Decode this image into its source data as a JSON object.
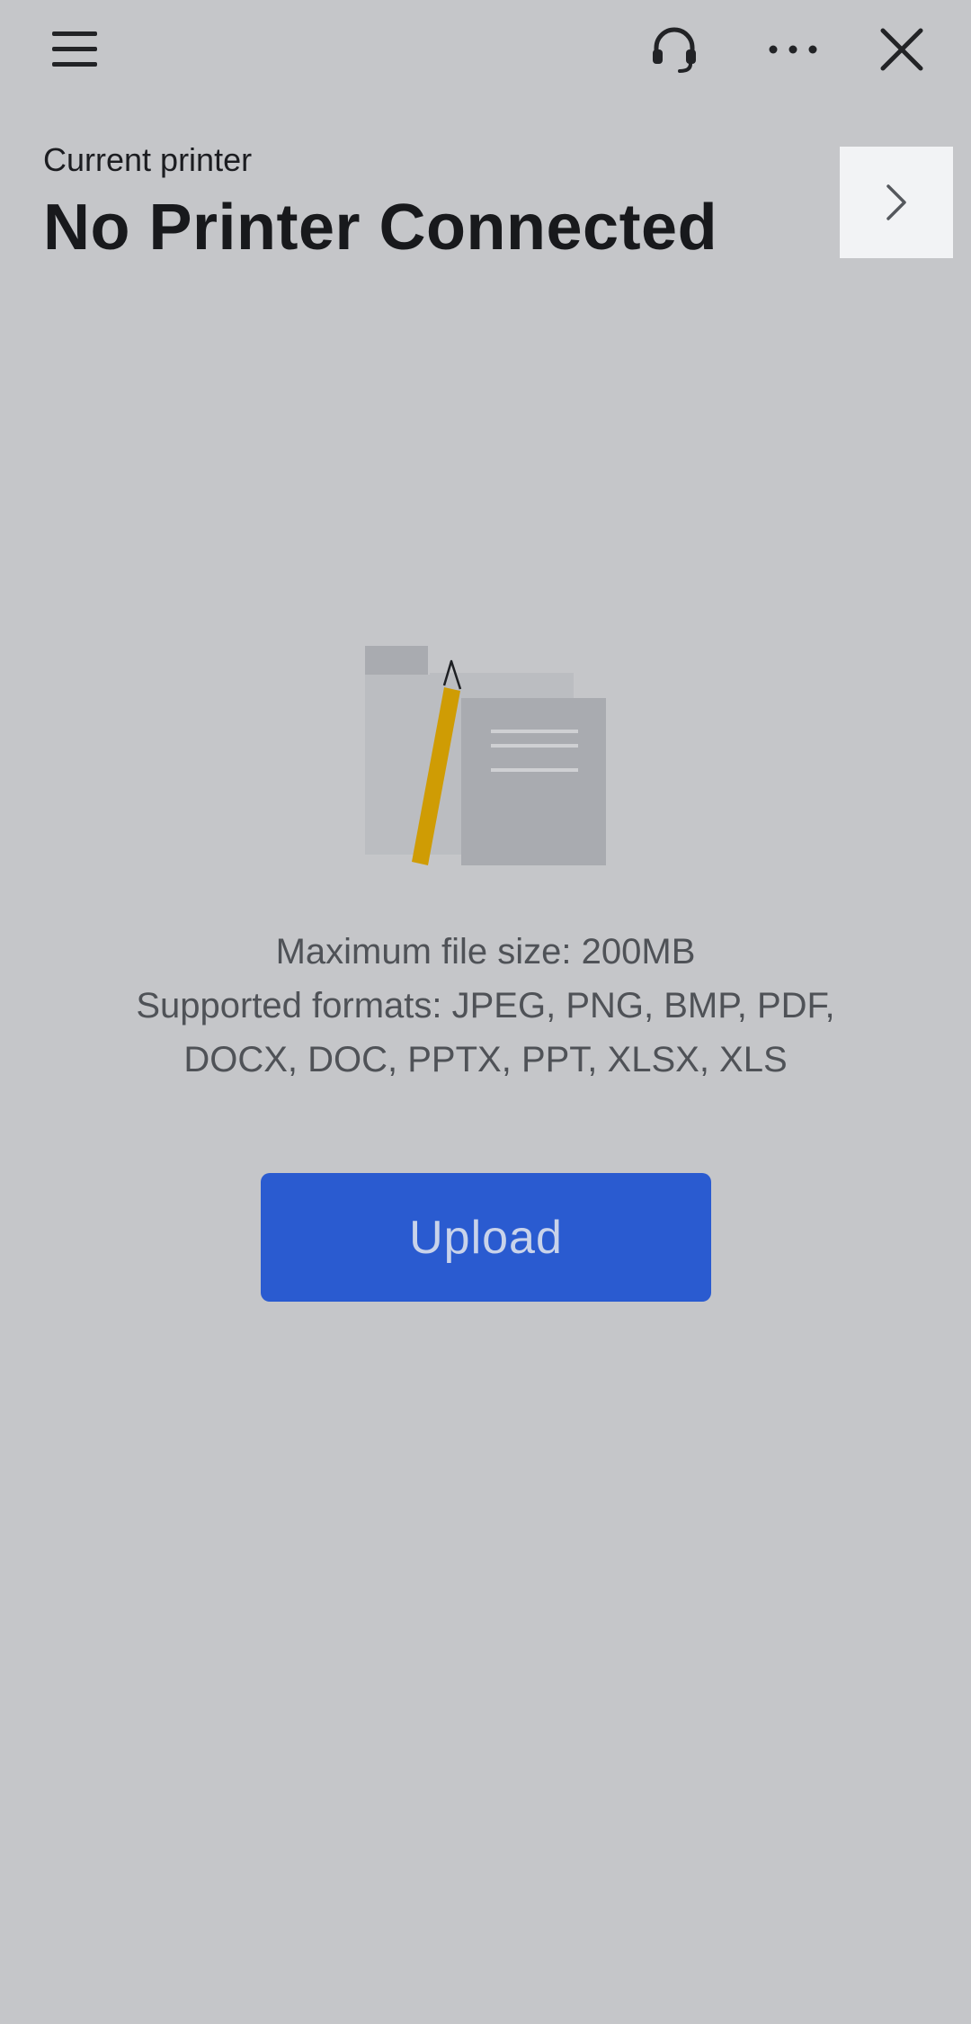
{
  "topbar": {
    "icons": [
      "hamburger-menu-icon",
      "headset-support-icon",
      "more-dots-icon",
      "close-icon"
    ]
  },
  "printer": {
    "subtitle": "Current printer",
    "title": "No Printer Connected",
    "arrow_icon": "chevron-right-icon"
  },
  "illustration": {
    "icon": "documents-pencil-illustration"
  },
  "info": {
    "max_size": "Maximum file size: 200MB",
    "formats_line1": "Supported formats: JPEG, PNG, BMP, PDF,",
    "formats_line2": "DOCX, DOC, PPTX, PPT, XLSX, XLS"
  },
  "upload": {
    "label": "Upload"
  },
  "colors": {
    "background": "#c5c6c9",
    "accent": "#2a5bd0",
    "pencil": "#cf9c04",
    "arrow_box": "#f2f3f5"
  }
}
